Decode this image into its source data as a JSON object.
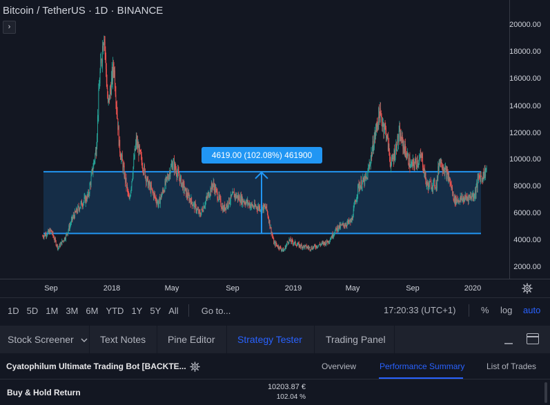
{
  "header": {
    "symbol_title": "Bitcoin / TetherUS · 1D · BINANCE",
    "collapse_glyph": "›"
  },
  "price_axis": {
    "labels": [
      "20000.00",
      "18000.00",
      "16000.00",
      "14000.00",
      "12000.00",
      "10000.00",
      "8000.00",
      "6000.00",
      "4000.00",
      "2000.00"
    ]
  },
  "time_axis": {
    "labels": [
      "Sep",
      "2018",
      "May",
      "Sep",
      "2019",
      "May",
      "Sep",
      "2020"
    ],
    "settings_icon": "gear-icon"
  },
  "measure_tool": {
    "label": "4619.00 (102.08%) 461900",
    "price_low": 4500,
    "price_high": 9119,
    "color": "#2196f3"
  },
  "range_bar": {
    "ranges": [
      "1D",
      "5D",
      "1M",
      "3M",
      "6M",
      "YTD",
      "1Y",
      "5Y",
      "All"
    ],
    "goto_label": "Go to...",
    "time_readout": "17:20:33 (UTC+1)",
    "percent_label": "%",
    "log_label": "log",
    "auto_label": "auto"
  },
  "bottom_tabs": {
    "stock_screener": "Stock Screener",
    "text_notes": "Text Notes",
    "pine_editor": "Pine Editor",
    "strategy_tester": "Strategy Tester",
    "trading_panel": "Trading Panel",
    "active": "Strategy Tester"
  },
  "strategy": {
    "name": "Cyatophilum Ultimate Trading Bot [BACKTE...",
    "tabs": [
      "Overview",
      "Performance Summary",
      "List of Trades"
    ],
    "active_tab": "Performance Summary"
  },
  "results": {
    "metric": "Buy & Hold Return",
    "value_amount": "10203.87 €",
    "value_percent": "102.04 %"
  },
  "colors": {
    "background": "#131722",
    "up": "#26a69a",
    "down": "#ef5350",
    "accent": "#2962ff",
    "measure": "#2196f3"
  },
  "chart_data": {
    "type": "candlestick",
    "symbol": "BTCUSDT",
    "exchange": "BINANCE",
    "interval": "1D",
    "ylim": [
      1000,
      21000
    ],
    "series": [
      {
        "x": "2017-08-15",
        "close": 4300
      },
      {
        "x": "2017-09-01",
        "close": 4700
      },
      {
        "x": "2017-09-15",
        "close": 3400
      },
      {
        "x": "2017-10-01",
        "close": 4300
      },
      {
        "x": "2017-10-15",
        "close": 5700
      },
      {
        "x": "2017-11-01",
        "close": 6700
      },
      {
        "x": "2017-11-15",
        "close": 7300
      },
      {
        "x": "2017-12-01",
        "close": 10800
      },
      {
        "x": "2017-12-08",
        "close": 16000
      },
      {
        "x": "2017-12-17",
        "close": 19700
      },
      {
        "x": "2017-12-25",
        "close": 14000
      },
      {
        "x": "2018-01-06",
        "close": 17100
      },
      {
        "x": "2018-01-17",
        "close": 11000
      },
      {
        "x": "2018-02-06",
        "close": 6900
      },
      {
        "x": "2018-02-20",
        "close": 11400
      },
      {
        "x": "2018-03-15",
        "close": 8300
      },
      {
        "x": "2018-04-06",
        "close": 6700
      },
      {
        "x": "2018-05-05",
        "close": 9800
      },
      {
        "x": "2018-06-01",
        "close": 7500
      },
      {
        "x": "2018-06-29",
        "close": 5900
      },
      {
        "x": "2018-07-25",
        "close": 8200
      },
      {
        "x": "2018-08-15",
        "close": 6300
      },
      {
        "x": "2018-09-05",
        "close": 7400
      },
      {
        "x": "2018-10-15",
        "close": 6500
      },
      {
        "x": "2018-11-10",
        "close": 6400
      },
      {
        "x": "2018-11-25",
        "close": 3800
      },
      {
        "x": "2018-12-15",
        "close": 3200
      },
      {
        "x": "2018-12-25",
        "close": 4000
      },
      {
        "x": "2019-01-15",
        "close": 3600
      },
      {
        "x": "2019-02-08",
        "close": 3400
      },
      {
        "x": "2019-03-15",
        "close": 3900
      },
      {
        "x": "2019-04-02",
        "close": 4900
      },
      {
        "x": "2019-05-01",
        "close": 5400
      },
      {
        "x": "2019-05-15",
        "close": 8000
      },
      {
        "x": "2019-06-01",
        "close": 8600
      },
      {
        "x": "2019-06-26",
        "close": 13500
      },
      {
        "x": "2019-07-10",
        "close": 12100
      },
      {
        "x": "2019-07-20",
        "close": 9600
      },
      {
        "x": "2019-08-06",
        "close": 11900
      },
      {
        "x": "2019-08-29",
        "close": 9500
      },
      {
        "x": "2019-09-20",
        "close": 10200
      },
      {
        "x": "2019-09-30",
        "close": 8100
      },
      {
        "x": "2019-10-20",
        "close": 8200
      },
      {
        "x": "2019-10-26",
        "close": 10100
      },
      {
        "x": "2019-11-15",
        "close": 8500
      },
      {
        "x": "2019-11-25",
        "close": 7000
      },
      {
        "x": "2019-12-15",
        "close": 7100
      },
      {
        "x": "2020-01-05",
        "close": 7400
      },
      {
        "x": "2020-01-14",
        "close": 8800
      },
      {
        "x": "2020-01-20",
        "close": 8700
      },
      {
        "x": "2020-01-30",
        "close": 9400
      }
    ]
  }
}
